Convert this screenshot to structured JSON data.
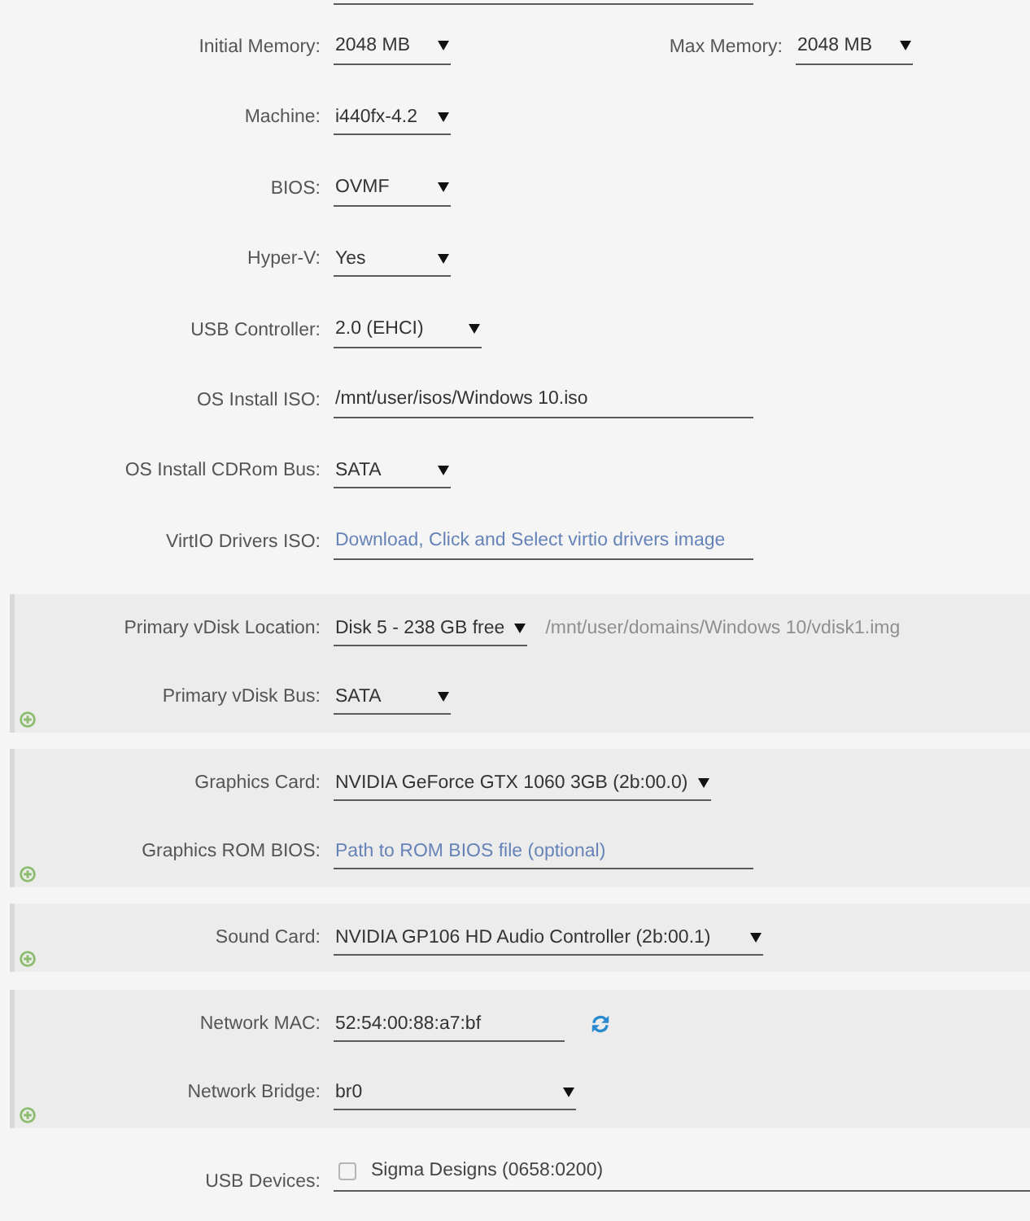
{
  "cut_off_field": {
    "kind": "input"
  },
  "rows": [
    {
      "label": "Initial Memory:",
      "control": {
        "kind": "select",
        "value": "2048 MB"
      },
      "paired": {
        "label": "Max Memory:",
        "control": {
          "kind": "select",
          "value": "2048 MB"
        }
      }
    },
    {
      "label": "Machine:",
      "control": {
        "kind": "select",
        "value": "i440fx-4.2"
      }
    },
    {
      "label": "BIOS:",
      "control": {
        "kind": "select",
        "value": "OVMF"
      }
    },
    {
      "label": "Hyper-V:",
      "control": {
        "kind": "select",
        "value": "Yes"
      }
    },
    {
      "label": "USB Controller:",
      "control": {
        "kind": "select",
        "value": "2.0 (EHCI)"
      }
    },
    {
      "label": "OS Install ISO:",
      "control": {
        "kind": "input",
        "value": "/mnt/user/isos/Windows 10.iso"
      }
    },
    {
      "label": "OS Install CDRom Bus:",
      "control": {
        "kind": "select",
        "value": "SATA"
      }
    },
    {
      "label": "VirtIO Drivers ISO:",
      "control": {
        "kind": "input",
        "placeholder": "Download, Click and Select virtio drivers image"
      }
    }
  ],
  "sections": [
    {
      "rows": [
        {
          "label": "Primary vDisk Location:",
          "control": {
            "kind": "select",
            "value": "Disk 5 - 238 GB free"
          },
          "path_field": {
            "kind": "input",
            "value": "/mnt/user/domains/Windows 10/vdisk1.img",
            "disabled": true
          }
        },
        {
          "label": "Primary vDisk Bus:",
          "control": {
            "kind": "select",
            "value": "SATA"
          }
        }
      ]
    },
    {
      "rows": [
        {
          "label": "Graphics Card:",
          "control": {
            "kind": "select",
            "value": "NVIDIA GeForce GTX 1060 3GB (2b:00.0)"
          }
        },
        {
          "label": "Graphics ROM BIOS:",
          "control": {
            "kind": "input",
            "placeholder": "Path to ROM BIOS file (optional)"
          }
        }
      ]
    },
    {
      "rows": [
        {
          "label": "Sound Card:",
          "control": {
            "kind": "select",
            "value": "NVIDIA GP106 HD Audio Controller (2b:00.1)"
          }
        }
      ]
    },
    {
      "rows": [
        {
          "label": "Network MAC:",
          "control": {
            "kind": "input",
            "value": "52:54:00:88:a7:bf"
          },
          "action": {
            "kind": "refresh"
          }
        },
        {
          "label": "Network Bridge:",
          "control": {
            "kind": "select",
            "value": "br0"
          }
        }
      ]
    }
  ],
  "usb_devices": {
    "label": "USB Devices:",
    "devices": [
      {
        "name": "Sigma Designs (0658:0200)",
        "checked": false
      }
    ]
  }
}
